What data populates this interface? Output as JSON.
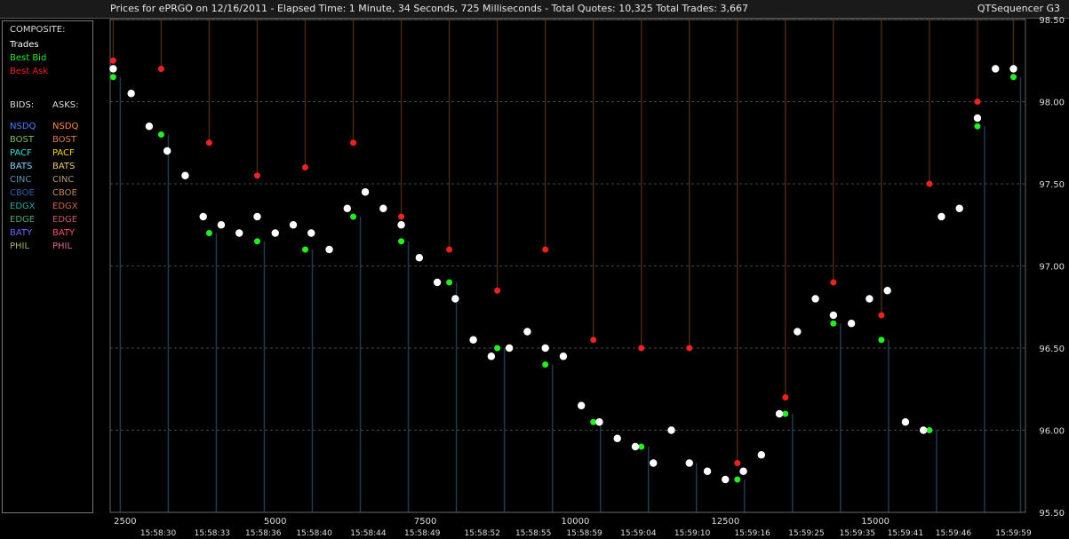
{
  "header": {
    "title": "Prices for  ePRGO  on  12/16/2011  -  Elapsed Time: 1 Minute, 34 Seconds, 725 Milliseconds  -  Total Quotes: 10,325  Total Trades: 3,667",
    "app_name": "QTSequencer G3"
  },
  "legend": {
    "composite_label": "COMPOSITE:",
    "trades": "Trades",
    "best_bid": "Best Bid",
    "best_ask": "Best Ask",
    "bids_label": "BIDS:",
    "asks_label": "ASKS:",
    "exchanges": [
      {
        "bid": "NSDQ",
        "ask": "NSDQ",
        "bid_color": "#4a7bff",
        "ask_color": "#ff8c3a"
      },
      {
        "bid": "BOST",
        "ask": "BOST",
        "bid_color": "#7fbf5a",
        "ask_color": "#d97a55"
      },
      {
        "bid": "PACF",
        "ask": "PACF",
        "bid_color": "#33e0e0",
        "ask_color": "#ffd21a"
      },
      {
        "bid": "BATS",
        "ask": "BATS",
        "bid_color": "#8ad4ff",
        "ask_color": "#f5c86a"
      },
      {
        "bid": "CINC",
        "ask": "CINC",
        "bid_color": "#5f8fb0",
        "ask_color": "#b09a78"
      },
      {
        "bid": "CBOE",
        "ask": "CBOE",
        "bid_color": "#2f5fa8",
        "ask_color": "#c48a4a"
      },
      {
        "bid": "EDGX",
        "ask": "EDGX",
        "bid_color": "#2aa39a",
        "ask_color": "#d0623a"
      },
      {
        "bid": "EDGE",
        "ask": "EDGE",
        "bid_color": "#4fa86a",
        "ask_color": "#c85a60"
      },
      {
        "bid": "BATY",
        "ask": "BATY",
        "bid_color": "#6a6aff",
        "ask_color": "#ff4a6a"
      },
      {
        "bid": "PHIL",
        "ask": "PHIL",
        "bid_color": "#9ab86a",
        "ask_color": "#e06a8a"
      }
    ],
    "colors": {
      "trades": "#ffffff",
      "best_bid": "#22ee22",
      "best_ask": "#ee2222",
      "label": "#dddddd"
    }
  },
  "chart_data": {
    "type": "scatter",
    "title": "",
    "xlabel": "",
    "ylabel": "",
    "ylim": [
      95.5,
      98.5
    ],
    "xlim": [
      2250,
      17500
    ],
    "grid": true,
    "y_ticks": [
      "95.50",
      "96.00",
      "96.50",
      "97.00",
      "97.50",
      "98.00",
      "98.50"
    ],
    "x_ticks_top": [
      {
        "label": "2500",
        "value": 2500
      },
      {
        "label": "5000",
        "value": 5000
      },
      {
        "label": "7500",
        "value": 7500
      },
      {
        "label": "10000",
        "value": 10000
      },
      {
        "label": "12500",
        "value": 12500
      },
      {
        "label": "15000",
        "value": 15000
      }
    ],
    "x_ticks_time": [
      {
        "label": "15:58:30",
        "value": 3050
      },
      {
        "label": "15:58:33",
        "value": 3950
      },
      {
        "label": "15:58:36",
        "value": 4800
      },
      {
        "label": "15:58:40",
        "value": 5650
      },
      {
        "label": "15:58:44",
        "value": 6550
      },
      {
        "label": "15:58:49",
        "value": 7450
      },
      {
        "label": "15:58:52",
        "value": 8450
      },
      {
        "label": "15:58:55",
        "value": 9300
      },
      {
        "label": "15:58:59",
        "value": 10150
      },
      {
        "label": "15:59:04",
        "value": 11050
      },
      {
        "label": "15:59:10",
        "value": 11950
      },
      {
        "label": "15:59:16",
        "value": 12950
      },
      {
        "label": "15:59:25",
        "value": 13850
      },
      {
        "label": "15:59:35",
        "value": 14700
      },
      {
        "label": "15:59:41",
        "value": 15500
      },
      {
        "label": "15:59:46",
        "value": 16300
      },
      {
        "label": "15:59:59",
        "value": 17300
      }
    ],
    "series": [
      {
        "name": "Trades",
        "color": "#ffffff",
        "x": [
          2300,
          2600,
          2900,
          3200,
          3500,
          3800,
          4100,
          4400,
          4700,
          5000,
          5300,
          5600,
          5900,
          6200,
          6500,
          6800,
          7100,
          7400,
          7700,
          8000,
          8300,
          8600,
          8900,
          9200,
          9500,
          9800,
          10100,
          10400,
          10700,
          11000,
          11300,
          11600,
          11900,
          12200,
          12500,
          12800,
          13100,
          13400,
          13700,
          14000,
          14300,
          14600,
          14900,
          15200,
          15500,
          15800,
          16100,
          16400,
          16700,
          17000,
          17300
        ],
        "values": [
          98.2,
          98.05,
          97.85,
          97.7,
          97.55,
          97.3,
          97.25,
          97.2,
          97.3,
          97.2,
          97.25,
          97.2,
          97.1,
          97.35,
          97.45,
          97.35,
          97.25,
          97.05,
          96.9,
          96.8,
          96.55,
          96.45,
          96.5,
          96.6,
          96.5,
          96.45,
          96.15,
          96.05,
          95.95,
          95.9,
          95.8,
          96.0,
          95.8,
          95.75,
          95.7,
          95.75,
          95.85,
          96.1,
          96.6,
          96.8,
          96.7,
          96.65,
          96.8,
          96.85,
          96.05,
          96.0,
          97.3,
          97.35,
          97.9,
          98.2,
          98.2
        ]
      },
      {
        "name": "Best Bid",
        "color": "#22ee22",
        "x": [
          2300,
          3100,
          3900,
          4700,
          5500,
          6300,
          7100,
          7900,
          8700,
          9500,
          10300,
          11100,
          11900,
          12700,
          13500,
          14300,
          15100,
          15900,
          16700,
          17300
        ],
        "values": [
          98.15,
          97.8,
          97.2,
          97.15,
          97.1,
          97.3,
          97.15,
          96.9,
          96.5,
          96.4,
          96.05,
          95.9,
          95.8,
          95.7,
          96.1,
          96.65,
          96.55,
          96.0,
          97.85,
          98.15
        ]
      },
      {
        "name": "Best Ask",
        "color": "#ee2222",
        "x": [
          2300,
          3100,
          3900,
          4700,
          5500,
          6300,
          7100,
          7900,
          8700,
          9500,
          10300,
          11100,
          11900,
          12700,
          13500,
          14300,
          15100,
          15900,
          16700,
          17300
        ],
        "values": [
          98.25,
          98.2,
          97.75,
          97.55,
          97.6,
          97.75,
          97.3,
          97.1,
          96.85,
          97.1,
          96.55,
          96.5,
          96.5,
          95.8,
          96.2,
          96.9,
          96.7,
          97.5,
          98.0,
          98.2
        ]
      }
    ]
  }
}
